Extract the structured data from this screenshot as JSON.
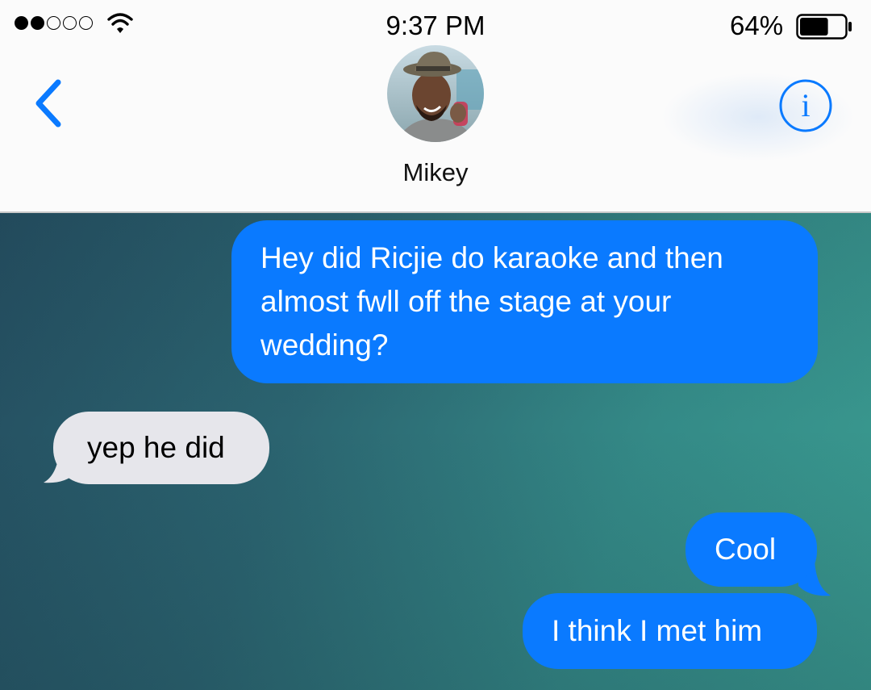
{
  "status_bar": {
    "time": "9:37 PM",
    "battery_percent": "64%",
    "battery_level": 0.64,
    "signal_bars_filled": 2,
    "signal_bars_total": 5
  },
  "nav": {
    "contact_name": "Mikey",
    "back_icon": "chevron-left-icon",
    "info_icon": "info-icon"
  },
  "colors": {
    "accent": "#0a7aff",
    "incoming_bubble": "#e6e6eb"
  },
  "messages": [
    {
      "direction": "outgoing",
      "text": "Hey did Ricjie do karaoke and then almost fwll off the stage at your wedding?"
    },
    {
      "direction": "incoming",
      "text": "yep he did"
    },
    {
      "direction": "outgoing",
      "text": "Cool"
    },
    {
      "direction": "outgoing",
      "text": "I think I met him"
    }
  ]
}
